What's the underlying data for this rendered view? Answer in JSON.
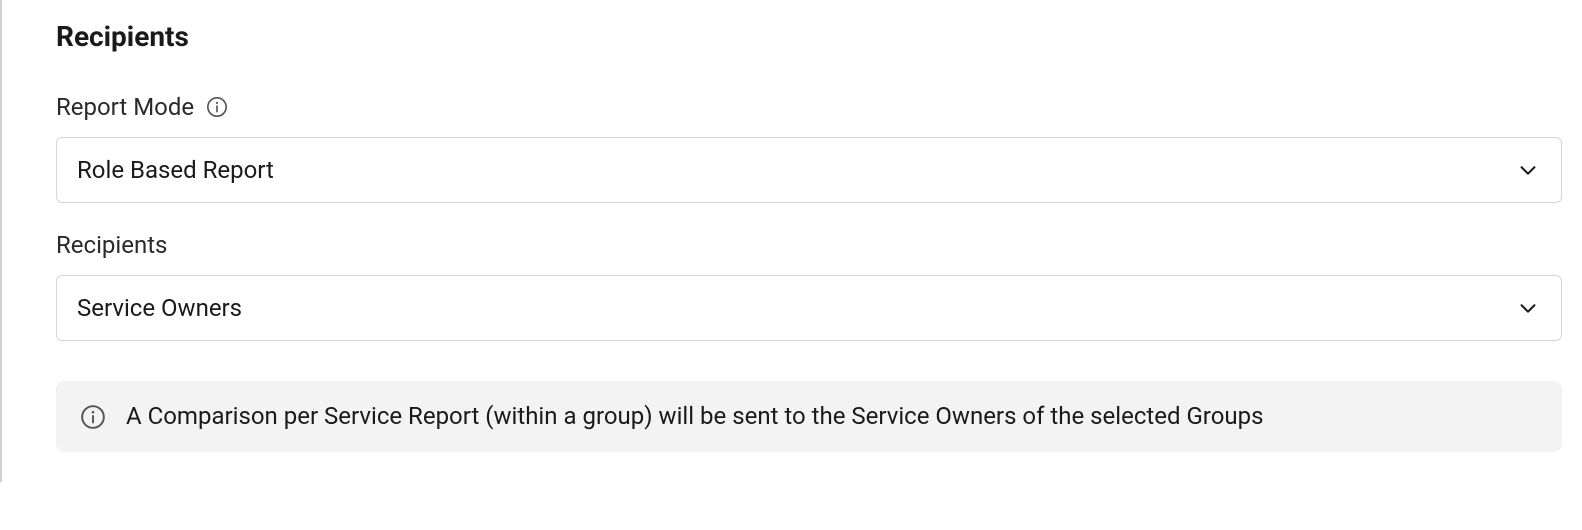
{
  "section": {
    "title": "Recipients"
  },
  "fields": {
    "reportMode": {
      "label": "Report Mode",
      "value": "Role Based Report"
    },
    "recipients": {
      "label": "Recipients",
      "value": "Service Owners"
    }
  },
  "infoBanner": {
    "text": "A Comparison per Service Report (within a group) will be sent to the Service Owners of the selected Groups"
  }
}
